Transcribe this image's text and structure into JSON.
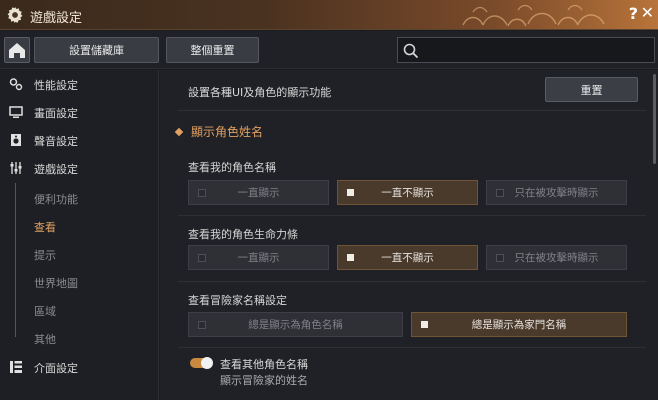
{
  "window": {
    "title": "遊戲設定",
    "help_label": "?",
    "close_label": "✕"
  },
  "toolbar": {
    "save_library_label": "設置儲藏庫",
    "reset_all_label": "整個重置",
    "search_placeholder": ""
  },
  "sidebar": {
    "items": [
      {
        "label": "性能設定",
        "icon": "performance-icon"
      },
      {
        "label": "畫面設定",
        "icon": "monitor-icon"
      },
      {
        "label": "聲音設定",
        "icon": "speaker-icon"
      },
      {
        "label": "遊戲設定",
        "icon": "sliders-icon"
      }
    ],
    "sub_items": [
      "便利功能",
      "查看",
      "提示",
      "世界地圖",
      "區域",
      "其他"
    ],
    "active_sub": "查看",
    "last_item": {
      "label": "介面設定",
      "icon": "interface-icon"
    }
  },
  "content": {
    "description": "設置各種UI及角色的顯示功能",
    "reset_label": "重置",
    "section_title": "顯示角色姓名",
    "groups": [
      {
        "label": "查看我的角色名稱",
        "options": [
          "一直顯示",
          "一直不顯示",
          "只在被攻擊時顯示"
        ],
        "selected": 1
      },
      {
        "label": "查看我的角色生命力條",
        "options": [
          "一直顯示",
          "一直不顯示",
          "只在被攻擊時顯示"
        ],
        "selected": 1
      },
      {
        "label": "查看冒險家名稱設定",
        "options": [
          "總是顯示為角色名稱",
          "總是顯示為家門名稱"
        ],
        "selected": 1
      }
    ],
    "toggle": {
      "label": "查看其他角色名稱",
      "sublabel": "顯示冒險家的姓名",
      "on": true
    }
  },
  "colors": {
    "accent": "#e0a060",
    "selected_bg": "#4a3a2c",
    "toggle_on": "#c98a3f"
  }
}
